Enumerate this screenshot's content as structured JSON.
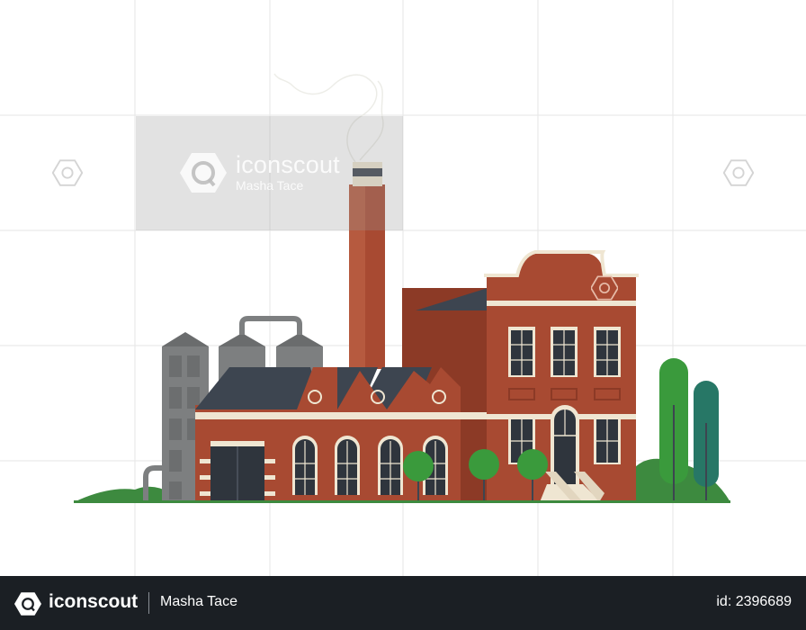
{
  "watermark": {
    "brand": "iconscout",
    "author": "Masha Tace"
  },
  "footer": {
    "brand": "iconscout",
    "author": "Masha Tace",
    "id_label": "id: 2396689"
  },
  "colors": {
    "brick": "#a84a32",
    "brick_dark": "#8c3a26",
    "roof": "#3d4550",
    "silo": "#7d7f80",
    "tree": "#3a9a3c",
    "trim": "#efe6d2",
    "footer_bg": "#1b1f24"
  }
}
